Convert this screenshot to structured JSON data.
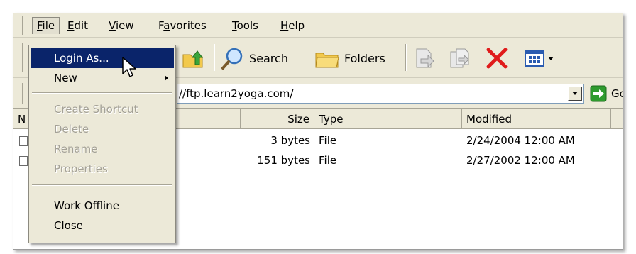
{
  "menubar": {
    "items": [
      {
        "label": "File",
        "mnemonic": "F"
      },
      {
        "label": "Edit",
        "mnemonic": "E"
      },
      {
        "label": "View",
        "mnemonic": "V"
      },
      {
        "label": "Favorites",
        "mnemonic": "a"
      },
      {
        "label": "Tools",
        "mnemonic": "T"
      },
      {
        "label": "Help",
        "mnemonic": "H"
      }
    ]
  },
  "file_menu": {
    "items": [
      {
        "label": "Login As...",
        "state": "highlighted"
      },
      {
        "label": "New",
        "state": "enabled",
        "submenu": true
      },
      {
        "label": "Create Shortcut",
        "state": "disabled"
      },
      {
        "label": "Delete",
        "state": "disabled"
      },
      {
        "label": "Rename",
        "state": "disabled"
      },
      {
        "label": "Properties",
        "state": "disabled"
      },
      {
        "label": "Work Offline",
        "state": "enabled"
      },
      {
        "label": "Close",
        "state": "enabled"
      }
    ]
  },
  "toolbar": {
    "search_label": "Search",
    "folders_label": "Folders",
    "icons": [
      "up-folder-icon",
      "search-icon",
      "folders-icon",
      "move-to-icon",
      "copy-to-icon",
      "delete-icon",
      "views-icon"
    ]
  },
  "address": {
    "value": "//ftp.learn2yoga.com/",
    "go_label": "Go"
  },
  "listview": {
    "columns": [
      "N",
      "Size",
      "Type",
      "Modified"
    ],
    "rows": [
      {
        "size": "3 bytes",
        "type": "File",
        "modified": "2/24/2004 12:00 AM"
      },
      {
        "size": "151 bytes",
        "type": "File",
        "modified": "2/27/2002 12:00 AM"
      }
    ]
  },
  "colors": {
    "window_bg": "#ece9d8",
    "menu_highlight": "#0a246a",
    "disabled_text": "#a4a196",
    "delete_red": "#e01b1b",
    "go_green": "#2f9b2f"
  }
}
